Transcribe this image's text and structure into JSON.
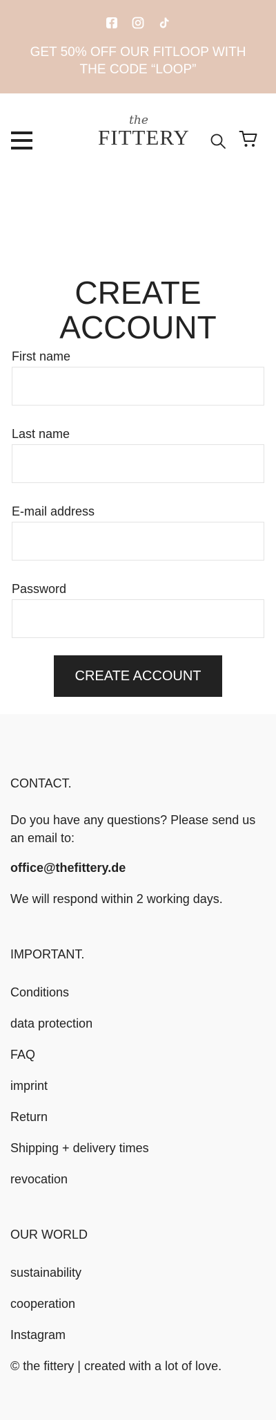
{
  "announcement": {
    "text": "GET 50% OFF OUR FITLOOP WITH THE CODE “LOOP”",
    "social_icons": [
      "facebook-icon",
      "instagram-icon",
      "tiktok-icon"
    ]
  },
  "header": {
    "logo_small": "the",
    "logo_main": "FITTERY",
    "icons": [
      "menu-icon",
      "search-icon",
      "cart-icon"
    ]
  },
  "form": {
    "title_line1": "CREATE",
    "title_line2": "ACCOUNT",
    "first_name_label": "First name",
    "last_name_label": "Last name",
    "email_label": "E-mail address",
    "password_label": "Password",
    "submit_label": "CREATE ACCOUNT"
  },
  "footer": {
    "contact_heading": "CONTACT.",
    "contact_text": "Do you have any questions? Please send us an email to:",
    "contact_email": "office@thefittery.de",
    "contact_response": "We will respond within 2 working days.",
    "important_heading": "IMPORTANT.",
    "important_links": [
      "Conditions",
      "data protection",
      "FAQ",
      "imprint",
      "Return",
      "Shipping + delivery times",
      "revocation"
    ],
    "world_heading": "OUR WORLD",
    "world_links": [
      "sustainability",
      "cooperation",
      "Instagram"
    ],
    "copyright": "© the fittery | created with a lot of love."
  },
  "colors": {
    "announcement_bg": "#e3c7b7",
    "button_bg": "#222222",
    "footer_bg": "#f9f9f9"
  }
}
